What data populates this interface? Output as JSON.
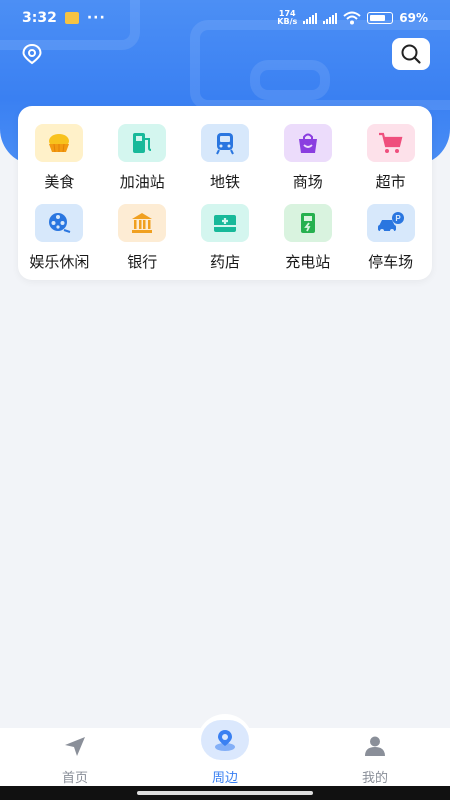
{
  "status": {
    "time": "3:32",
    "dots": "···",
    "net_speed_top": "174",
    "net_speed_bottom": "KB/s",
    "battery": "69%"
  },
  "categories": [
    {
      "label": "美食",
      "icon": "bun-icon",
      "bg": "#fff1c9"
    },
    {
      "label": "加油站",
      "icon": "fuel-pump-icon",
      "bg": "#d4f6ef"
    },
    {
      "label": "地铁",
      "icon": "subway-icon",
      "bg": "#d7e8fb"
    },
    {
      "label": "商场",
      "icon": "shopping-bag-icon",
      "bg": "#ecdcfb"
    },
    {
      "label": "超市",
      "icon": "shopping-cart-icon",
      "bg": "#fde1ea"
    },
    {
      "label": "娱乐休闲",
      "icon": "film-reel-icon",
      "bg": "#d7e8fb"
    },
    {
      "label": "银行",
      "icon": "bank-icon",
      "bg": "#fdecd4"
    },
    {
      "label": "药店",
      "icon": "medicine-box-icon",
      "bg": "#d4f6ef"
    },
    {
      "label": "充电站",
      "icon": "charging-station-icon",
      "bg": "#d9f3df"
    },
    {
      "label": "停车场",
      "icon": "parking-car-icon",
      "bg": "#d7e8fb"
    }
  ],
  "tabs": [
    {
      "label": "首页",
      "icon": "navigation-arrow-icon",
      "active": false
    },
    {
      "label": "周边",
      "icon": "nearby-location-icon",
      "active": true
    },
    {
      "label": "我的",
      "icon": "user-icon",
      "active": false
    }
  ],
  "colors": {
    "accent": "#3a80f2",
    "header_bg": "#4c8ff5",
    "page_bg": "#f2f4f8"
  }
}
